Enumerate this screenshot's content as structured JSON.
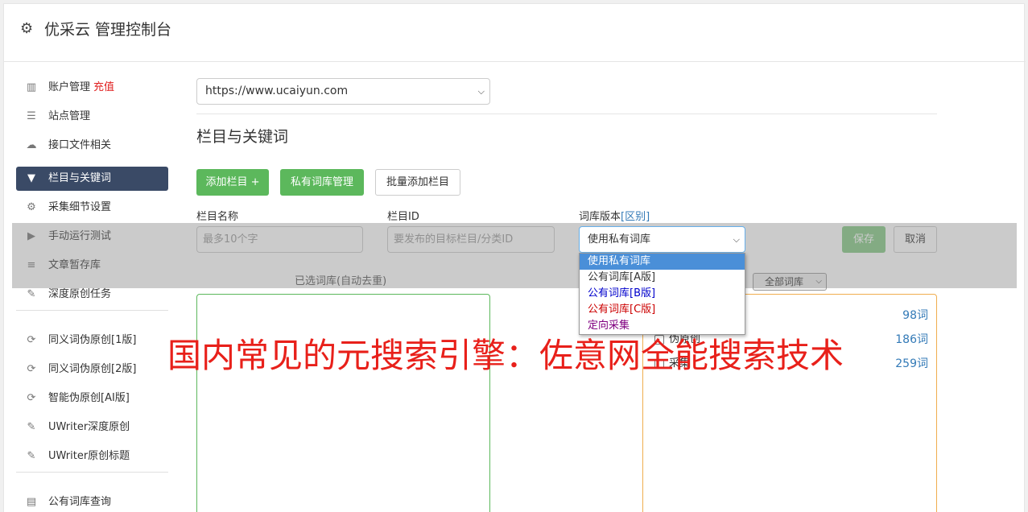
{
  "header": {
    "title": "优采云 管理控制台",
    "icon": "gear-icon"
  },
  "sidebar": {
    "items": [
      {
        "label": "账户管理",
        "badge": "充值",
        "icon": "bar-chart-icon",
        "glyph": "▥"
      },
      {
        "label": "站点管理",
        "icon": "server-icon",
        "glyph": "☰"
      },
      {
        "label": "接口文件相关",
        "icon": "cloud-upload-icon",
        "glyph": "☁"
      },
      {
        "label": "栏目与关键词",
        "icon": "filter-icon",
        "glyph": "▼",
        "active": true
      },
      {
        "label": "采集细节设置",
        "icon": "cogs-icon",
        "glyph": "⚙"
      },
      {
        "label": "手动运行测试",
        "icon": "play-circle-icon",
        "glyph": "▶"
      },
      {
        "label": "文章暂存库",
        "icon": "database-icon",
        "glyph": "≡"
      },
      {
        "label": "深度原创任务",
        "icon": "edit-icon",
        "glyph": "✎"
      },
      {
        "label": "同义词伪原创[1版]",
        "icon": "refresh-icon",
        "glyph": "⟳"
      },
      {
        "label": "同义词伪原创[2版]",
        "icon": "refresh-icon",
        "glyph": "⟳"
      },
      {
        "label": "智能伪原创[AI版]",
        "icon": "refresh-icon",
        "glyph": "⟳"
      },
      {
        "label": "UWriter深度原创",
        "icon": "edit-icon",
        "glyph": "✎"
      },
      {
        "label": "UWriter原创标题",
        "icon": "edit-icon",
        "glyph": "✎"
      },
      {
        "label": "公有词库查询",
        "icon": "book-icon",
        "glyph": "▤"
      }
    ]
  },
  "site_select": {
    "value": "https://www.ucaiyun.com"
  },
  "section_title": "栏目与关键词",
  "buttons": {
    "add_column": "添加栏目 +",
    "private_lib": "私有词库管理",
    "batch_add": "批量添加栏目",
    "save": "保存",
    "cancel": "取消"
  },
  "form": {
    "name_label": "栏目名称",
    "name_placeholder": "最多10个字",
    "id_label": "栏目ID",
    "id_placeholder": "要发布的目标栏目/分类ID",
    "version_label": "词库版本",
    "version_link": "[区别]",
    "version_value": "使用私有词库"
  },
  "dropdown": {
    "options": [
      {
        "label": "使用私有词库",
        "color": "#ffffff",
        "selected": true
      },
      {
        "label": "公有词库[A版]",
        "color": "#333333"
      },
      {
        "label": "公有词库[B版]",
        "color": "#0000cc"
      },
      {
        "label": "公有词库[C版]",
        "color": "#cc0000"
      },
      {
        "label": "定向采集",
        "color": "#800080"
      }
    ]
  },
  "selected_box": {
    "label": "已选词库(自动去重)"
  },
  "library_filter": {
    "value": "全部词库"
  },
  "libraries": [
    {
      "name": "",
      "count": "98词"
    },
    {
      "name": "伪原创",
      "count": "186词"
    },
    {
      "name": "采集",
      "count": "259词"
    }
  ],
  "watermark": "国内常见的元搜索引擎：佐意网全能搜索技术",
  "colors": {
    "accent_green": "#5cb85c",
    "active_nav": "#3a4a66",
    "badge_red": "#e02020",
    "link_blue": "#337ab7",
    "box_orange": "#f0ad4e"
  }
}
